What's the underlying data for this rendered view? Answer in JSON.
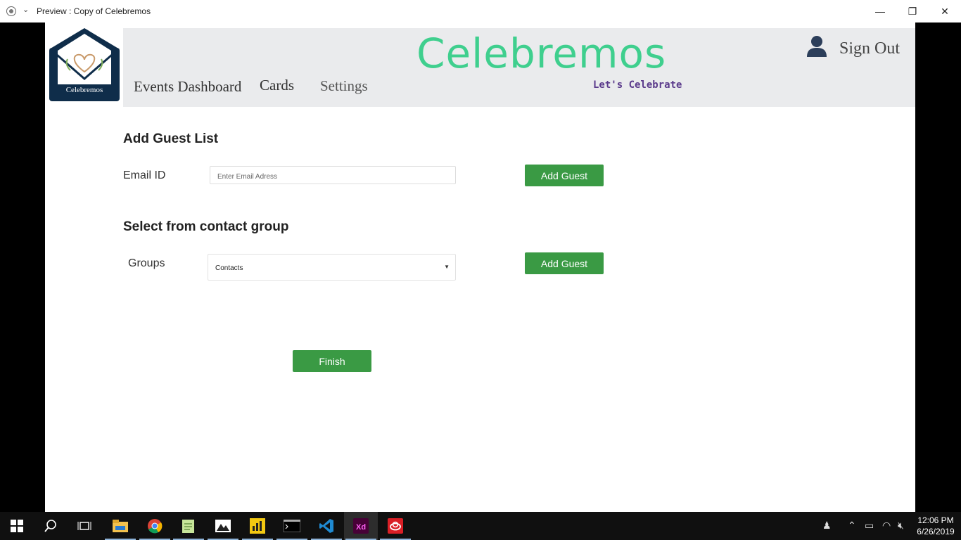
{
  "window": {
    "title": "Preview : Copy of Celebremos",
    "minimize_label": "—",
    "restore_label": "❐",
    "close_label": "✕"
  },
  "header": {
    "brand": "Celebremos",
    "tagline": "Let's Celebrate",
    "logo_text": "Celebremos",
    "nav": {
      "events": "Events Dashboard",
      "cards": "Cards",
      "settings": "Settings"
    },
    "signout": "Sign Out"
  },
  "add_guest_list": {
    "heading": "Add Guest List",
    "email_label": "Email ID",
    "email_placeholder": "Enter Email Adress",
    "button": "Add Guest"
  },
  "contact_group": {
    "heading": "Select from contact group",
    "groups_label": "Groups",
    "selected": "Contacts",
    "button": "Add Guest"
  },
  "finish_button": "Finish",
  "taskbar": {
    "time": "12:06 PM",
    "date": "6/26/2019",
    "apps": [
      "start-icon",
      "search-icon",
      "task-view-icon",
      "file-explorer-icon",
      "chrome-icon",
      "notepad-icon",
      "photos-icon",
      "power-bi-icon",
      "terminal-icon",
      "vscode-icon",
      "adobe-xd-icon",
      "creative-cloud-icon"
    ]
  }
}
